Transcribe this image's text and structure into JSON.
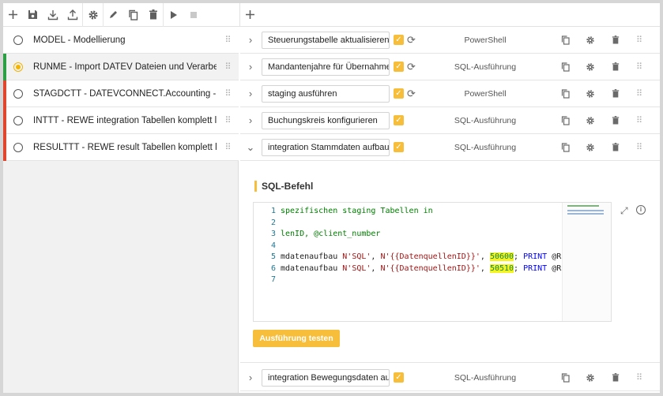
{
  "toolbar": {
    "icons": [
      "add-icon",
      "save-icon",
      "download-icon",
      "upload-icon",
      "settings-icon",
      "edit-icon",
      "copy-icon",
      "delete-icon",
      "play-icon",
      "stop-icon"
    ],
    "add_step_icon": "add-icon"
  },
  "modules": [
    {
      "label": "MODEL - Modellierung",
      "status_color": "",
      "selected": false
    },
    {
      "label": "RUNME - Import DATEV Dateien und Verarbeitung",
      "status_color": "#2e9e44",
      "selected": true
    },
    {
      "label": "STAGDCTT - DATEVCONNECT.Accounting - stagin",
      "status_color": "#e0452e",
      "selected": false
    },
    {
      "label": "INTTT - REWE integration Tabellen komplett leere",
      "status_color": "#e0452e",
      "selected": false
    },
    {
      "label": "RESULTTT - REWE result Tabellen komplett leeren",
      "status_color": "#e0452e",
      "selected": false
    }
  ],
  "steps": [
    {
      "name": "Steuerungstabelle aktualisieren",
      "type": "PowerShell",
      "refresh": true,
      "expanded": false
    },
    {
      "name": "Mandantenjahre für Übernahme de",
      "type": "SQL-Ausführung",
      "refresh": true,
      "expanded": false
    },
    {
      "name": "staging ausführen",
      "type": "PowerShell",
      "refresh": true,
      "expanded": false
    },
    {
      "name": "Buchungskreis konfigurieren",
      "type": "SQL-Ausführung",
      "refresh": false,
      "expanded": false
    },
    {
      "name": "integration Stammdaten aufbauen",
      "type": "SQL-Ausführung",
      "refresh": false,
      "expanded": true
    },
    {
      "name": "integration Bewegungsdaten aufba",
      "type": "SQL-Ausführung",
      "refresh": false,
      "expanded": false
    }
  ],
  "sql_panel": {
    "title": "SQL-Befehl",
    "line_numbers": [
      "1",
      "2",
      "3",
      "4",
      "5",
      "6",
      "7"
    ],
    "line1": "spezifischen staging Tabellen in",
    "line3": "lenID, @client_number",
    "line5_a": "mdatenaufbau ",
    "line5_b": "N'SQL'",
    "line5_c": ", ",
    "line5_d": "N'{{DatenquellenID}}'",
    "line5_e": ", ",
    "line5_num": "50600",
    "line5_f": "; ",
    "line5_g": "PRINT",
    "line5_h": " @RC",
    "line6_a": "mdatenaufbau ",
    "line6_b": "N'SQL'",
    "line6_c": ", ",
    "line6_d": "N'{{DatenquellenID}}'",
    "line6_e": ", ",
    "line6_num": "50510",
    "line6_f": "; ",
    "line6_g": "PRINT",
    "line6_h": " @RC",
    "run_label": "Ausführung testen"
  },
  "colors": {
    "accent": "#f6be3b",
    "ok": "#2e9e44",
    "error": "#e0452e"
  }
}
